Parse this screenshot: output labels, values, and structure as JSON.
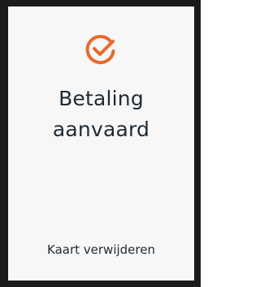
{
  "status": {
    "icon": "check-circle-icon",
    "title_line1": "Betaling",
    "title_line2": "aanvaard",
    "accent_color": "#e86a2b"
  },
  "actions": {
    "remove_card_label": "Kaart verwijderen"
  }
}
